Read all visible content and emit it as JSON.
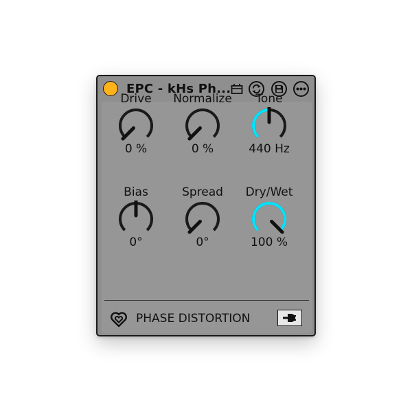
{
  "device": {
    "title": "EPC - kHs Ph...",
    "name": "PHASE DISTORTION",
    "power_on": true
  },
  "colors": {
    "power": "#ffb31a",
    "arc_active": "#00e5ff",
    "arc_track": "#1a1a1a",
    "panel": "#969696"
  },
  "icons": {
    "chain": "chain-icon",
    "hot_swap": "hot-swap-icon",
    "save": "save-icon",
    "more": "more-icon",
    "logo": "heart-logo-icon",
    "plug": "plug-icon"
  },
  "knobs": [
    {
      "id": "drive",
      "label": "Drive",
      "value": "0 %",
      "level": 0.0,
      "mode": "unipolar"
    },
    {
      "id": "normalize",
      "label": "Normalize",
      "value": "0 %",
      "level": 0.0,
      "mode": "unipolar"
    },
    {
      "id": "tone",
      "label": "Tone",
      "value": "440 Hz",
      "level": 0.5,
      "mode": "unipolar"
    },
    {
      "id": "bias",
      "label": "Bias",
      "value": "0°",
      "level": 0.5,
      "mode": "bipolar"
    },
    {
      "id": "spread",
      "label": "Spread",
      "value": "0°",
      "level": 0.0,
      "mode": "unipolar"
    },
    {
      "id": "drywet",
      "label": "Dry/Wet",
      "value": "100 %",
      "level": 1.0,
      "mode": "unipolar"
    }
  ]
}
